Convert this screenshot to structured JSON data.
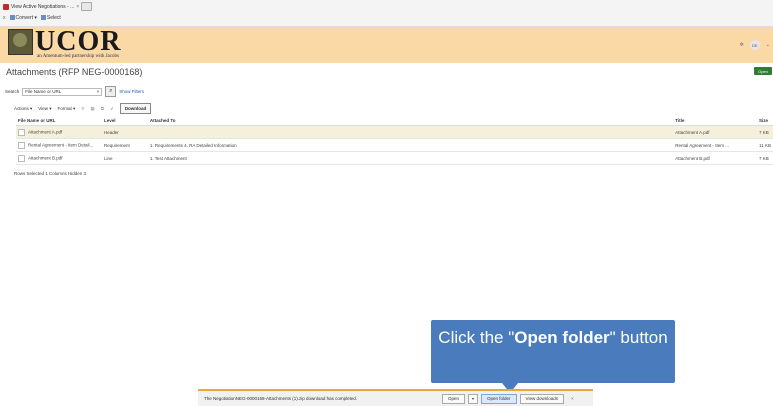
{
  "browser": {
    "tab_title": "View Active Negotiations - ...",
    "tab_close": "×",
    "cmd_close": "x",
    "convert": "Convert",
    "select": "Select"
  },
  "header": {
    "brand": "UCOR",
    "tagline": "an Amentum-led partnership with Jacobs",
    "user_initials": "DE"
  },
  "page": {
    "title": "Attachments (RFP NEG-0000168)",
    "open_button": "Open"
  },
  "search": {
    "label": "Search",
    "field_value": "File Name or URL",
    "clear": "×",
    "show_filters": "Show Filters"
  },
  "toolbar": {
    "actions": "Actions ▾",
    "view": "View ▾",
    "format": "Format ▾",
    "download": "Download"
  },
  "table": {
    "columns": [
      "File Name or URL",
      "Level",
      "Attached To",
      "Title",
      "Size"
    ],
    "rows": [
      {
        "file": "Attachment A.pdf",
        "level": "Header",
        "attached_to": "",
        "title": "Attachment A.pdf",
        "size": "7 KB"
      },
      {
        "file": "Rental Agreement - Item Detail...",
        "level": "Requirement",
        "attached_to": "1. Requirements 4. RA Detailed Information",
        "title": "Rental Agreement - Item ...",
        "size": "11 KB"
      },
      {
        "file": "Attachment B.pdf",
        "level": "Line",
        "attached_to": "1. Test Attachment",
        "title": "Attachment B.pdf",
        "size": "7 KB"
      }
    ],
    "footer": "Rows Selected 1    Columns Hidden 3"
  },
  "callout": {
    "prefix": "Click the \"",
    "bold": "Open folder",
    "suffix": "\" button"
  },
  "download_bar": {
    "message": "The NegotiationNEG-0000168-Attachments (1).zip download has completed.",
    "open": "Open",
    "open_folder": "Open folder",
    "view_downloads": "View downloads",
    "close": "×"
  },
  "colors": {
    "header_bg": "#fbd9a6",
    "open_button": "#2e7d32",
    "callout": "#4a7bbd",
    "link": "#1a5fa8"
  }
}
